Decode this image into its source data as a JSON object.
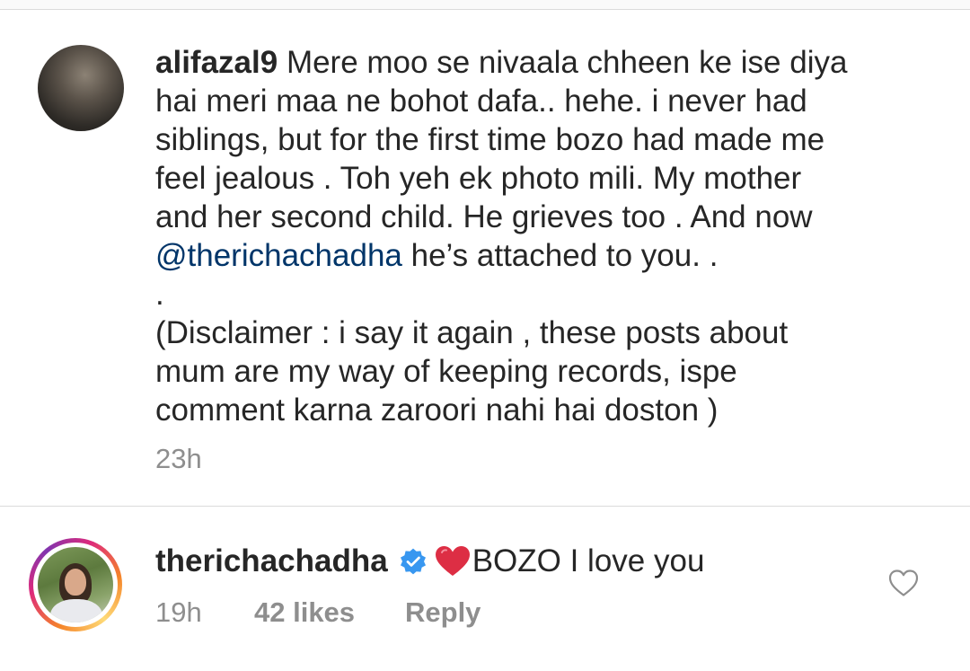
{
  "caption": {
    "username": "alifazal9",
    "text_lines": [
      "Mere moo se nivaala chheen ke ise diya",
      "hai meri maa ne bohot dafa.. hehe. i never had",
      "siblings, but for the first time bozo had made me",
      "feel jealous . Toh yeh ek photo mili. My mother",
      "and her second child. He grieves too . And now"
    ],
    "mention": "@therichachadha",
    "mention_suffix": " he’s attached to you. .",
    "dot_line": ".",
    "disclaimer_lines": [
      "(Disclaimer : i say it again , these posts about",
      "mum are my way of keeping records, ispe",
      "comment karna zaroori nahi hai doston )"
    ],
    "time": "23h"
  },
  "comment": {
    "username": "therichachadha",
    "text": "BOZO I love you",
    "time": "19h",
    "likes": "42 likes",
    "reply_label": "Reply"
  },
  "icons": {
    "verified": "verified-badge-icon",
    "heart_emoji": "red-heart-emoji-icon",
    "like": "heart-outline-icon"
  },
  "colors": {
    "text": "#262626",
    "secondary": "#8e8e8e",
    "mention": "#003569",
    "verified": "#3897f0",
    "heart": "#e0245e"
  }
}
